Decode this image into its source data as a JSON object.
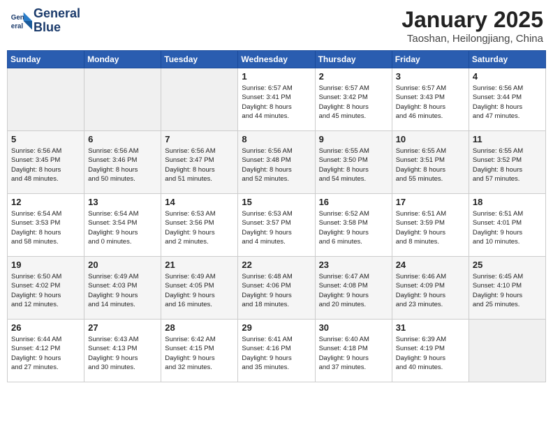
{
  "header": {
    "logo_line1": "General",
    "logo_line2": "Blue",
    "month_year": "January 2025",
    "location": "Taoshan, Heilongjiang, China"
  },
  "weekdays": [
    "Sunday",
    "Monday",
    "Tuesday",
    "Wednesday",
    "Thursday",
    "Friday",
    "Saturday"
  ],
  "weeks": [
    [
      {
        "day": "",
        "info": ""
      },
      {
        "day": "",
        "info": ""
      },
      {
        "day": "",
        "info": ""
      },
      {
        "day": "1",
        "info": "Sunrise: 6:57 AM\nSunset: 3:41 PM\nDaylight: 8 hours\nand 44 minutes."
      },
      {
        "day": "2",
        "info": "Sunrise: 6:57 AM\nSunset: 3:42 PM\nDaylight: 8 hours\nand 45 minutes."
      },
      {
        "day": "3",
        "info": "Sunrise: 6:57 AM\nSunset: 3:43 PM\nDaylight: 8 hours\nand 46 minutes."
      },
      {
        "day": "4",
        "info": "Sunrise: 6:56 AM\nSunset: 3:44 PM\nDaylight: 8 hours\nand 47 minutes."
      }
    ],
    [
      {
        "day": "5",
        "info": "Sunrise: 6:56 AM\nSunset: 3:45 PM\nDaylight: 8 hours\nand 48 minutes."
      },
      {
        "day": "6",
        "info": "Sunrise: 6:56 AM\nSunset: 3:46 PM\nDaylight: 8 hours\nand 50 minutes."
      },
      {
        "day": "7",
        "info": "Sunrise: 6:56 AM\nSunset: 3:47 PM\nDaylight: 8 hours\nand 51 minutes."
      },
      {
        "day": "8",
        "info": "Sunrise: 6:56 AM\nSunset: 3:48 PM\nDaylight: 8 hours\nand 52 minutes."
      },
      {
        "day": "9",
        "info": "Sunrise: 6:55 AM\nSunset: 3:50 PM\nDaylight: 8 hours\nand 54 minutes."
      },
      {
        "day": "10",
        "info": "Sunrise: 6:55 AM\nSunset: 3:51 PM\nDaylight: 8 hours\nand 55 minutes."
      },
      {
        "day": "11",
        "info": "Sunrise: 6:55 AM\nSunset: 3:52 PM\nDaylight: 8 hours\nand 57 minutes."
      }
    ],
    [
      {
        "day": "12",
        "info": "Sunrise: 6:54 AM\nSunset: 3:53 PM\nDaylight: 8 hours\nand 58 minutes."
      },
      {
        "day": "13",
        "info": "Sunrise: 6:54 AM\nSunset: 3:54 PM\nDaylight: 9 hours\nand 0 minutes."
      },
      {
        "day": "14",
        "info": "Sunrise: 6:53 AM\nSunset: 3:56 PM\nDaylight: 9 hours\nand 2 minutes."
      },
      {
        "day": "15",
        "info": "Sunrise: 6:53 AM\nSunset: 3:57 PM\nDaylight: 9 hours\nand 4 minutes."
      },
      {
        "day": "16",
        "info": "Sunrise: 6:52 AM\nSunset: 3:58 PM\nDaylight: 9 hours\nand 6 minutes."
      },
      {
        "day": "17",
        "info": "Sunrise: 6:51 AM\nSunset: 3:59 PM\nDaylight: 9 hours\nand 8 minutes."
      },
      {
        "day": "18",
        "info": "Sunrise: 6:51 AM\nSunset: 4:01 PM\nDaylight: 9 hours\nand 10 minutes."
      }
    ],
    [
      {
        "day": "19",
        "info": "Sunrise: 6:50 AM\nSunset: 4:02 PM\nDaylight: 9 hours\nand 12 minutes."
      },
      {
        "day": "20",
        "info": "Sunrise: 6:49 AM\nSunset: 4:03 PM\nDaylight: 9 hours\nand 14 minutes."
      },
      {
        "day": "21",
        "info": "Sunrise: 6:49 AM\nSunset: 4:05 PM\nDaylight: 9 hours\nand 16 minutes."
      },
      {
        "day": "22",
        "info": "Sunrise: 6:48 AM\nSunset: 4:06 PM\nDaylight: 9 hours\nand 18 minutes."
      },
      {
        "day": "23",
        "info": "Sunrise: 6:47 AM\nSunset: 4:08 PM\nDaylight: 9 hours\nand 20 minutes."
      },
      {
        "day": "24",
        "info": "Sunrise: 6:46 AM\nSunset: 4:09 PM\nDaylight: 9 hours\nand 23 minutes."
      },
      {
        "day": "25",
        "info": "Sunrise: 6:45 AM\nSunset: 4:10 PM\nDaylight: 9 hours\nand 25 minutes."
      }
    ],
    [
      {
        "day": "26",
        "info": "Sunrise: 6:44 AM\nSunset: 4:12 PM\nDaylight: 9 hours\nand 27 minutes."
      },
      {
        "day": "27",
        "info": "Sunrise: 6:43 AM\nSunset: 4:13 PM\nDaylight: 9 hours\nand 30 minutes."
      },
      {
        "day": "28",
        "info": "Sunrise: 6:42 AM\nSunset: 4:15 PM\nDaylight: 9 hours\nand 32 minutes."
      },
      {
        "day": "29",
        "info": "Sunrise: 6:41 AM\nSunset: 4:16 PM\nDaylight: 9 hours\nand 35 minutes."
      },
      {
        "day": "30",
        "info": "Sunrise: 6:40 AM\nSunset: 4:18 PM\nDaylight: 9 hours\nand 37 minutes."
      },
      {
        "day": "31",
        "info": "Sunrise: 6:39 AM\nSunset: 4:19 PM\nDaylight: 9 hours\nand 40 minutes."
      },
      {
        "day": "",
        "info": ""
      }
    ]
  ]
}
